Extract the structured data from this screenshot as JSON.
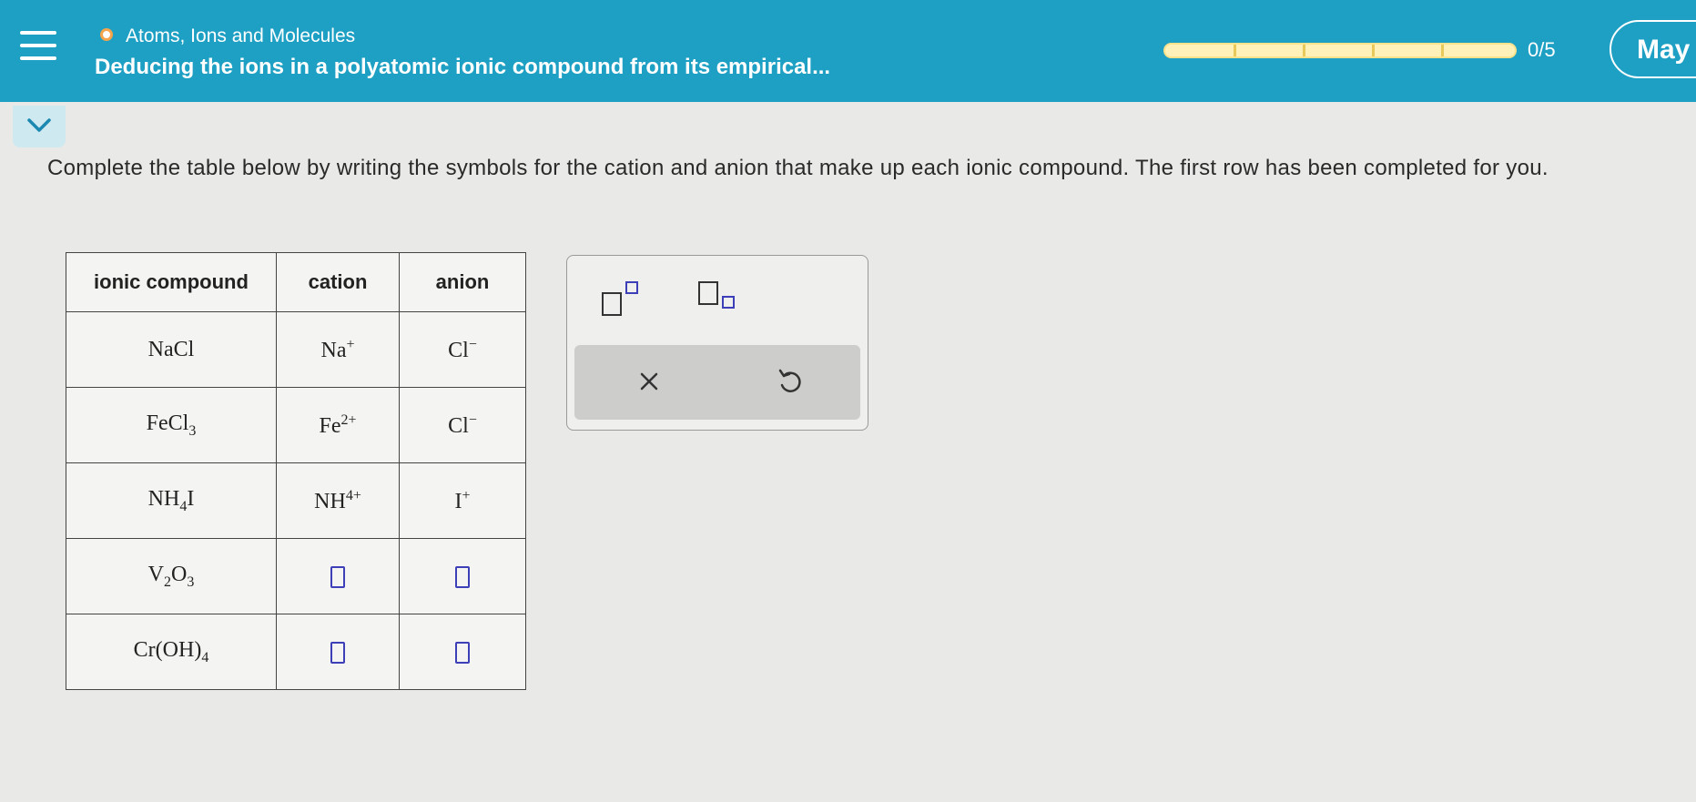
{
  "header": {
    "topic": "Atoms, Ions and Molecules",
    "lesson_title": "Deducing the ions in a polyatomic ionic compound from its empirical...",
    "progress_text": "0/5",
    "progress_fraction": 0,
    "user_name": "May",
    "colors": {
      "header_bg": "#1ea0c4",
      "progress_fill": "#fff1b8",
      "topic_dot": "#f6a44c"
    }
  },
  "instructions": "Complete the table below by writing the symbols for the cation and anion that make up each ionic compound. The first row has been completed for you.",
  "table": {
    "headers": [
      "ionic compound",
      "cation",
      "anion"
    ],
    "rows": [
      {
        "compound": "NaCl",
        "cation": "Na",
        "cation_charge": "+",
        "anion": "Cl",
        "anion_charge": "−"
      },
      {
        "compound": "FeCl3",
        "cation": "Fe",
        "cation_charge": "2+",
        "anion": "Cl",
        "anion_charge": "−"
      },
      {
        "compound": "NH4I",
        "cation": "NH",
        "cation_charge": "4+",
        "anion": "I",
        "anion_charge": "+"
      },
      {
        "compound": "V2O3",
        "cation": "",
        "anion": ""
      },
      {
        "compound": "Cr(OH)4",
        "cation": "",
        "anion": ""
      }
    ]
  },
  "toolbox": {
    "tools": [
      "superscript-tool",
      "subscript-tool"
    ],
    "clear_label": "×",
    "undo_icon": "undo-icon"
  }
}
